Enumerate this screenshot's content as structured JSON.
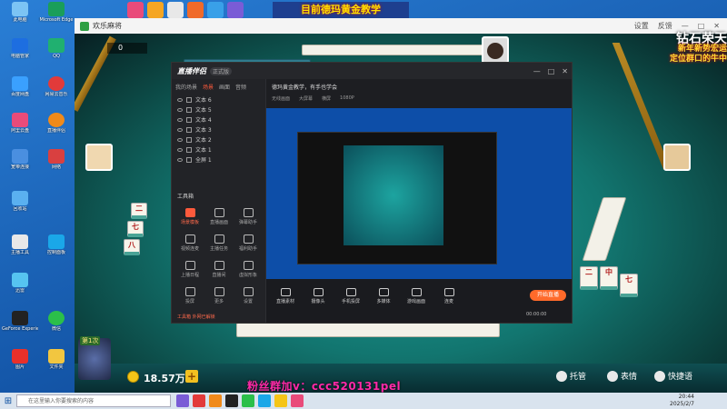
{
  "banner": {
    "text": "目前德玛黄金教学"
  },
  "desktop": {
    "icons": [
      {
        "label": "此电脑"
      },
      {
        "label": "Microsoft Edge"
      },
      {
        "label": "电脑管家"
      },
      {
        "label": "QQ"
      },
      {
        "label": "百度网盘"
      },
      {
        "label": "网易云音乐"
      },
      {
        "label": "阿里云盘"
      },
      {
        "label": "直播伴侣"
      },
      {
        "label": "宽带连接"
      },
      {
        "label": "网络"
      },
      {
        "label": "回收站"
      },
      {
        "label": "主播工具"
      },
      {
        "label": "控制面板"
      },
      {
        "label": "迅雷"
      },
      {
        "label": "GeForce Experience"
      },
      {
        "label": "微信"
      },
      {
        "label": "图片"
      },
      {
        "label": "文件夹"
      }
    ]
  },
  "game": {
    "window_title": "欢乐麻将",
    "title_right": [
      "设置",
      "反馈",
      "—",
      "□",
      "✕"
    ],
    "score_top": "0",
    "overlay_top_right": [
      "钻石荣天",
      "新年新势宏运",
      "定位群口的牛中"
    ],
    "coins": "18.57万",
    "plus": "+",
    "rank_label": "第1次",
    "promo": "粉丝群加v：ccc520131pel",
    "buttons": {
      "tuoguan": "托管",
      "biaoqing": "表情",
      "kuaijie": "快捷语"
    },
    "tiles_left": [
      "二",
      "七",
      "八"
    ],
    "tiles_right": [
      "二",
      "中",
      "七"
    ]
  },
  "obs": {
    "brand": "直播伴侣",
    "version": "正式版",
    "header_controls": [
      "—",
      "□",
      "✕"
    ],
    "tabs": [
      "我的场景",
      "场景",
      "画面",
      "音频"
    ],
    "scenes": [
      "文本 6",
      "文本 5",
      "文本 4",
      "文本 3",
      "文本 2",
      "文本 1",
      "全屏 1"
    ],
    "tools_title": "工具箱",
    "tools": [
      {
        "label": "场景模板",
        "active": true
      },
      {
        "label": "直播画面",
        "active": false
      },
      {
        "label": "弹幕助手",
        "active": false
      },
      {
        "label": "视频连麦",
        "active": false
      },
      {
        "label": "主播任务",
        "active": false
      },
      {
        "label": "福利助手",
        "active": false
      },
      {
        "label": "上播日程",
        "active": false
      },
      {
        "label": "直播间",
        "active": false
      },
      {
        "label": "虚拟形象",
        "active": false
      },
      {
        "label": "投屏",
        "active": false
      },
      {
        "label": "更多",
        "active": false
      },
      {
        "label": "设置",
        "active": false
      }
    ],
    "footer_note": "工具箱 外网已解锁",
    "title_field": "德玛黄金教学，有手也学会",
    "topbar_items": [
      "无线画面",
      "大屏幕",
      "横屏",
      "1080P"
    ],
    "bottom_buttons": [
      "直播素材",
      "摄像头",
      "手机投屏",
      "多媒体",
      "游戏画面",
      "连麦"
    ],
    "start_button": "开始直播",
    "elapsed": "00:00:00"
  },
  "taskbar": {
    "search_placeholder": "在这里输入你要搜索的内容",
    "time": "20:44",
    "date": "2025/2/7"
  }
}
